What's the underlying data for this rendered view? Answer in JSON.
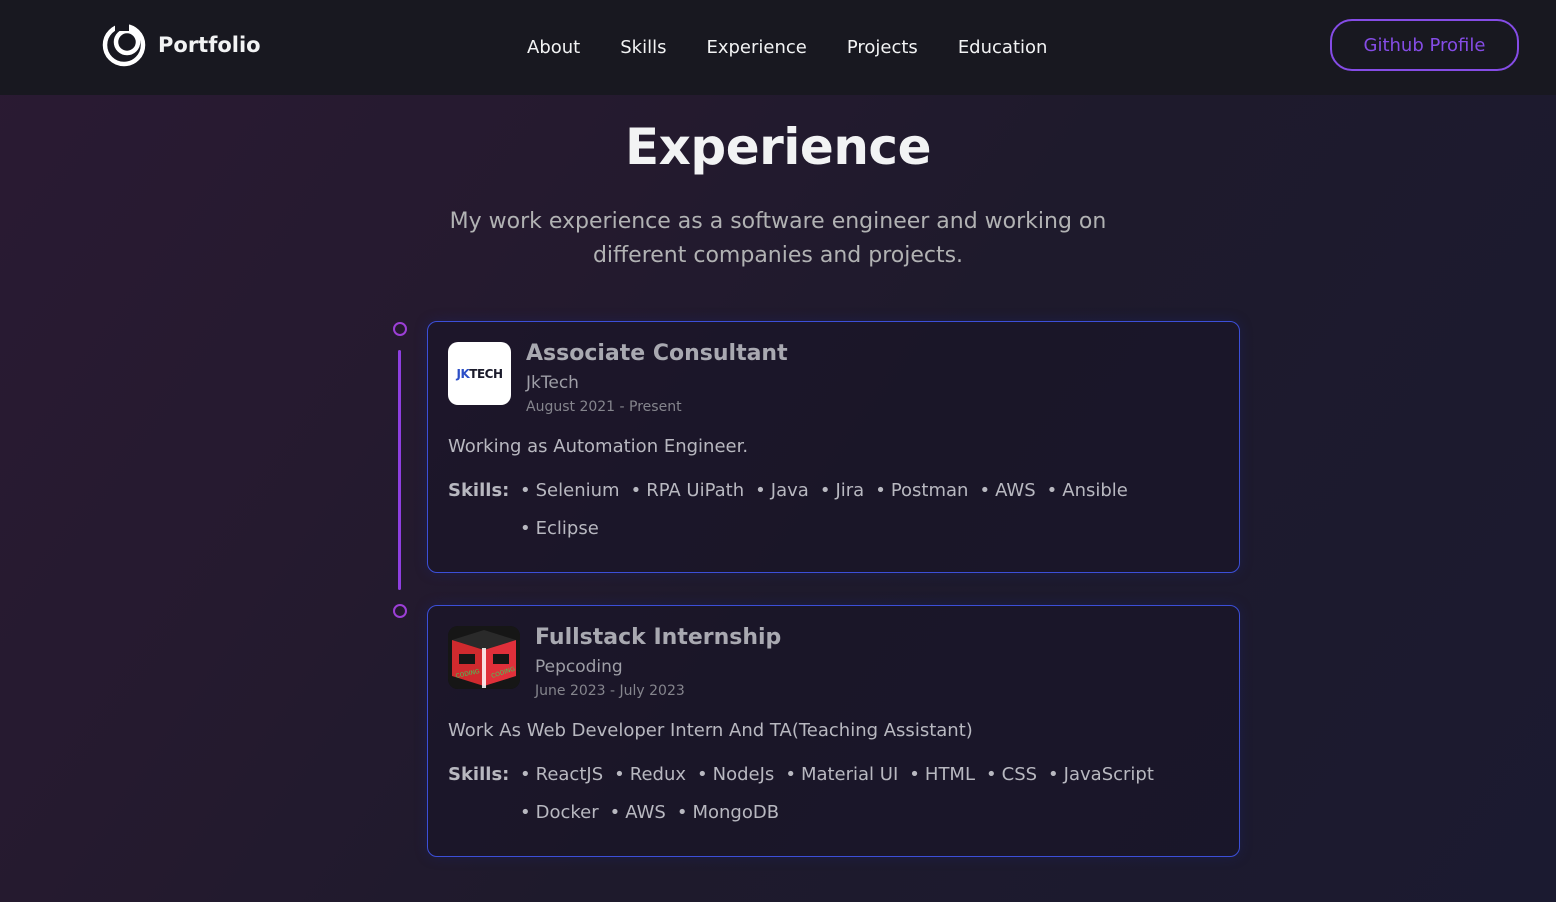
{
  "nav": {
    "brand": "Portfolio",
    "links": [
      "About",
      "Skills",
      "Experience",
      "Projects",
      "Education"
    ],
    "github_label": "Github Profile"
  },
  "section": {
    "title": "Experience",
    "description_line1": "My work experience as a software engineer and working on",
    "description_line2": "different companies and projects."
  },
  "experiences": [
    {
      "role": "Associate Consultant",
      "company": "JkTech",
      "date": "August 2021 - Present",
      "logo_text": "JK TECH",
      "description": "Working as Automation Engineer.",
      "skills_label": "Skills:",
      "skills_row1": [
        "Selenium",
        "RPA UiPath",
        "Java",
        "Jira",
        "Postman",
        "AWS",
        "Ansible"
      ],
      "skills_row2": [
        "Eclipse"
      ]
    },
    {
      "role": "Fullstack Internship",
      "company": "Pepcoding",
      "date": "June 2023 - July 2023",
      "description": "Work As Web Developer Intern And TA(Teaching Assistant)",
      "skills_label": "Skills:",
      "skills_row1": [
        "ReactJS",
        "Redux",
        "NodeJs",
        "Material UI",
        "HTML",
        "CSS",
        "JavaScript"
      ],
      "skills_row2": [
        "Docker",
        "AWS",
        "MongoDB"
      ]
    }
  ],
  "colors": {
    "accent": "#854ce6",
    "card_border": "#3c4fd8",
    "timeline": "#8e3fe0",
    "nav_bg": "#181820"
  }
}
